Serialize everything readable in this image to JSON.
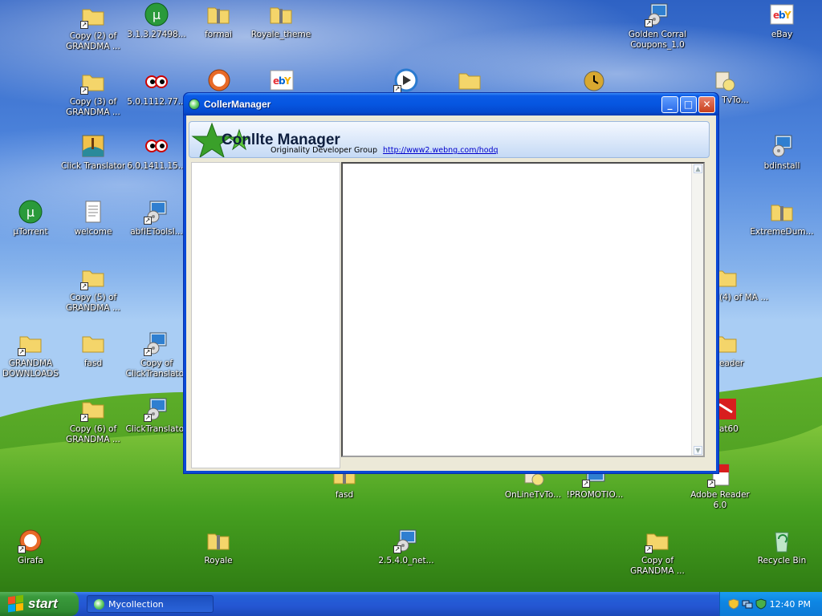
{
  "desktop": {
    "icons": [
      {
        "id": "copy2",
        "label": "Copy (2) of GRANDMA ..."
      },
      {
        "id": "ut31",
        "label": "3.1.3.27498..."
      },
      {
        "id": "formai",
        "label": "formai"
      },
      {
        "id": "royale_theme",
        "label": "Royale_theme"
      },
      {
        "id": "golden",
        "label": "Golden Corral Coupons_1.0"
      },
      {
        "id": "ebay",
        "label": "eBay"
      },
      {
        "id": "copy3",
        "label": "Copy (3) of GRANDMA ..."
      },
      {
        "id": "v50",
        "label": "5.0.1112.77..."
      },
      {
        "id": "onlinetv_top",
        "label": "TvTo..."
      },
      {
        "id": "clicktrans",
        "label": "Click Translator"
      },
      {
        "id": "v60",
        "label": "6.0.1411.15..."
      },
      {
        "id": "bdinstall",
        "label": "bdinstall"
      },
      {
        "id": "utorrent",
        "label": "µTorrent"
      },
      {
        "id": "welcome",
        "label": "welcome"
      },
      {
        "id": "abfie",
        "label": "abfIEToolsI..."
      },
      {
        "id": "extremedum",
        "label": "ExtremeDum..."
      },
      {
        "id": "copy5",
        "label": "Copy (5) of GRANDMA ..."
      },
      {
        "id": "copy4",
        "label": "(4) of MA ..."
      },
      {
        "id": "grandma_dl",
        "label": "GRANDMA DOWNLOADS"
      },
      {
        "id": "fasd1",
        "label": "fasd"
      },
      {
        "id": "copyclick",
        "label": "Copy of ClickTranslator"
      },
      {
        "id": "reader",
        "label": "eader"
      },
      {
        "id": "copy6",
        "label": "Copy (6) of GRANDMA ..."
      },
      {
        "id": "clicktranslator",
        "label": "ClickTranslator"
      },
      {
        "id": "at60",
        "label": "at60"
      },
      {
        "id": "fasd2",
        "label": "fasd"
      },
      {
        "id": "onlinetv",
        "label": "OnLineTvTo..."
      },
      {
        "id": "promotio",
        "label": "!PROMOTIO..."
      },
      {
        "id": "adobe",
        "label": "Adobe Reader 6.0"
      },
      {
        "id": "girafa",
        "label": "Girafa"
      },
      {
        "id": "royale",
        "label": "Royale"
      },
      {
        "id": "net254",
        "label": "2.5.4.0_net..."
      },
      {
        "id": "copygm",
        "label": "Copy of GRANDMA ..."
      },
      {
        "id": "recycle",
        "label": "Recycle Bin"
      }
    ]
  },
  "window": {
    "title": "CollerManager",
    "banner_title": "Conllte Manager",
    "banner_subtitle": "Originality Developer Group",
    "banner_link": "http://www2.webng.com/hodq"
  },
  "taskbar": {
    "start_label": "start",
    "task_item": "Mycollection",
    "clock": "12:40 PM"
  },
  "colors": {
    "xp_blue": "#0656e0",
    "start_green": "#3a9a3c",
    "tray_blue": "#0e86e4"
  }
}
